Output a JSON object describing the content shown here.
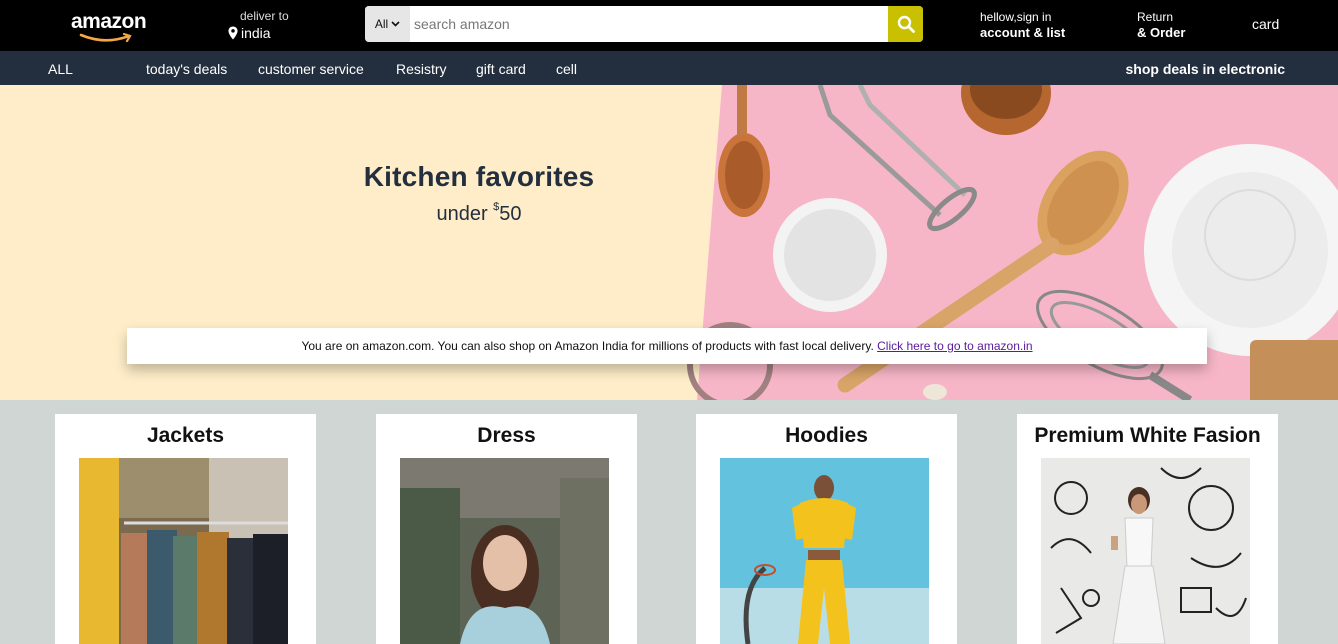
{
  "header": {
    "logo_text": "amazon",
    "deliver_label": "deliver to",
    "deliver_location": "india",
    "search_category": "All",
    "search_placeholder": "search amazon",
    "account_line1": "hellow,sign in",
    "account_line2": "account & list",
    "returns_line1": "Return",
    "returns_line2": "& Order",
    "cart_label": "card"
  },
  "nav": {
    "items": [
      "ALL",
      "today's deals",
      "customer service",
      "Resistry",
      "gift card",
      "cell"
    ],
    "promo": "shop deals in electronic"
  },
  "hero": {
    "title": "Kitchen favorites",
    "subtitle_prefix": "under ",
    "subtitle_currency": "$",
    "subtitle_amount": "50"
  },
  "notice": {
    "text": "You are on amazon.com. You can also shop on Amazon India for millions of products with fast local delivery. ",
    "link": "Click here to go to amazon.in"
  },
  "cards": [
    {
      "title": "Jackets"
    },
    {
      "title": "Dress"
    },
    {
      "title": "Hoodies"
    },
    {
      "title": "Premium White Fasion"
    }
  ],
  "colors": {
    "header_bg": "#000000",
    "nav_bg": "#232f3e",
    "hero_bg": "#feedc8",
    "hero_pink": "#f7b6c7",
    "search_button": "#c8c000",
    "page_bg": "#cfd6d3"
  },
  "icons": [
    "location-pin-icon",
    "chevron-down-icon",
    "search-icon"
  ]
}
